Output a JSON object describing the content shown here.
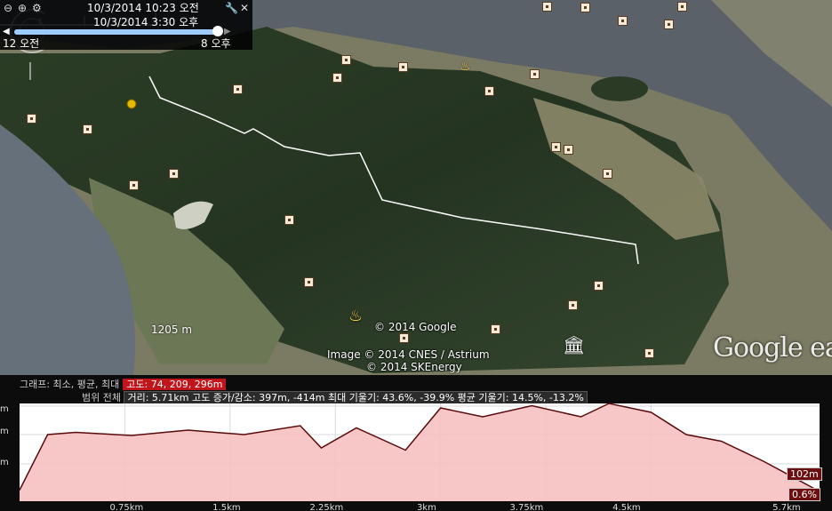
{
  "time_slider": {
    "start": "10/3/2014  10:23 오전",
    "end": "10/3/2014  3:30 오후",
    "min_label": "12 오전",
    "max_label": "8 오후",
    "position": 0.98
  },
  "map": {
    "scale_label": "1205 m",
    "credits": [
      "© 2014 Google",
      "Image © 2014 CNES / Astrium",
      "© 2014 SKEnergy"
    ],
    "brand": "Google earth"
  },
  "profile": {
    "stats_prefix": "그래프: 최소, 평균, 최대",
    "elevation_stat": "고도: 74, 209, 296m",
    "range_prefix": "범위 전체",
    "range_stats": "거리: 5.71km 고도 증가/감소: 397m, -414m  최대 기울기: 43.6%, -39.9%  평균 기울기: 14.5%, -13.2%",
    "y_unit": "m",
    "x_ticks": [
      "0.75km",
      "1.5km",
      "2.25km",
      "3km",
      "3.75km",
      "4.5km",
      "5.7km"
    ],
    "end_elevation": "102m",
    "end_grade": "0.6%"
  },
  "chart_data": {
    "type": "area",
    "title": "",
    "xlabel": "",
    "ylabel": "",
    "x": [
      0,
      0.2,
      0.4,
      0.8,
      1.2,
      1.6,
      2.0,
      2.15,
      2.4,
      2.75,
      3.0,
      3.3,
      3.65,
      4.0,
      4.2,
      4.5,
      4.75,
      5.0,
      5.3,
      5.7
    ],
    "values": [
      105,
      230,
      235,
      228,
      240,
      230,
      250,
      200,
      245,
      195,
      290,
      270,
      295,
      270,
      300,
      280,
      230,
      215,
      170,
      102
    ],
    "xlim": [
      0,
      5.7
    ],
    "ylim": [
      80,
      300
    ],
    "colors": {
      "line": "#5a0a0a",
      "fill": "#f6c1c1"
    }
  },
  "colors": {
    "highlight": "#c0151a",
    "track": "#ffffff",
    "water": "#5b6168"
  },
  "icons": [
    "zoom-out-icon",
    "zoom-in-icon",
    "settings-icon",
    "wrench-icon",
    "close-icon",
    "temple-icon",
    "museum-icon"
  ]
}
